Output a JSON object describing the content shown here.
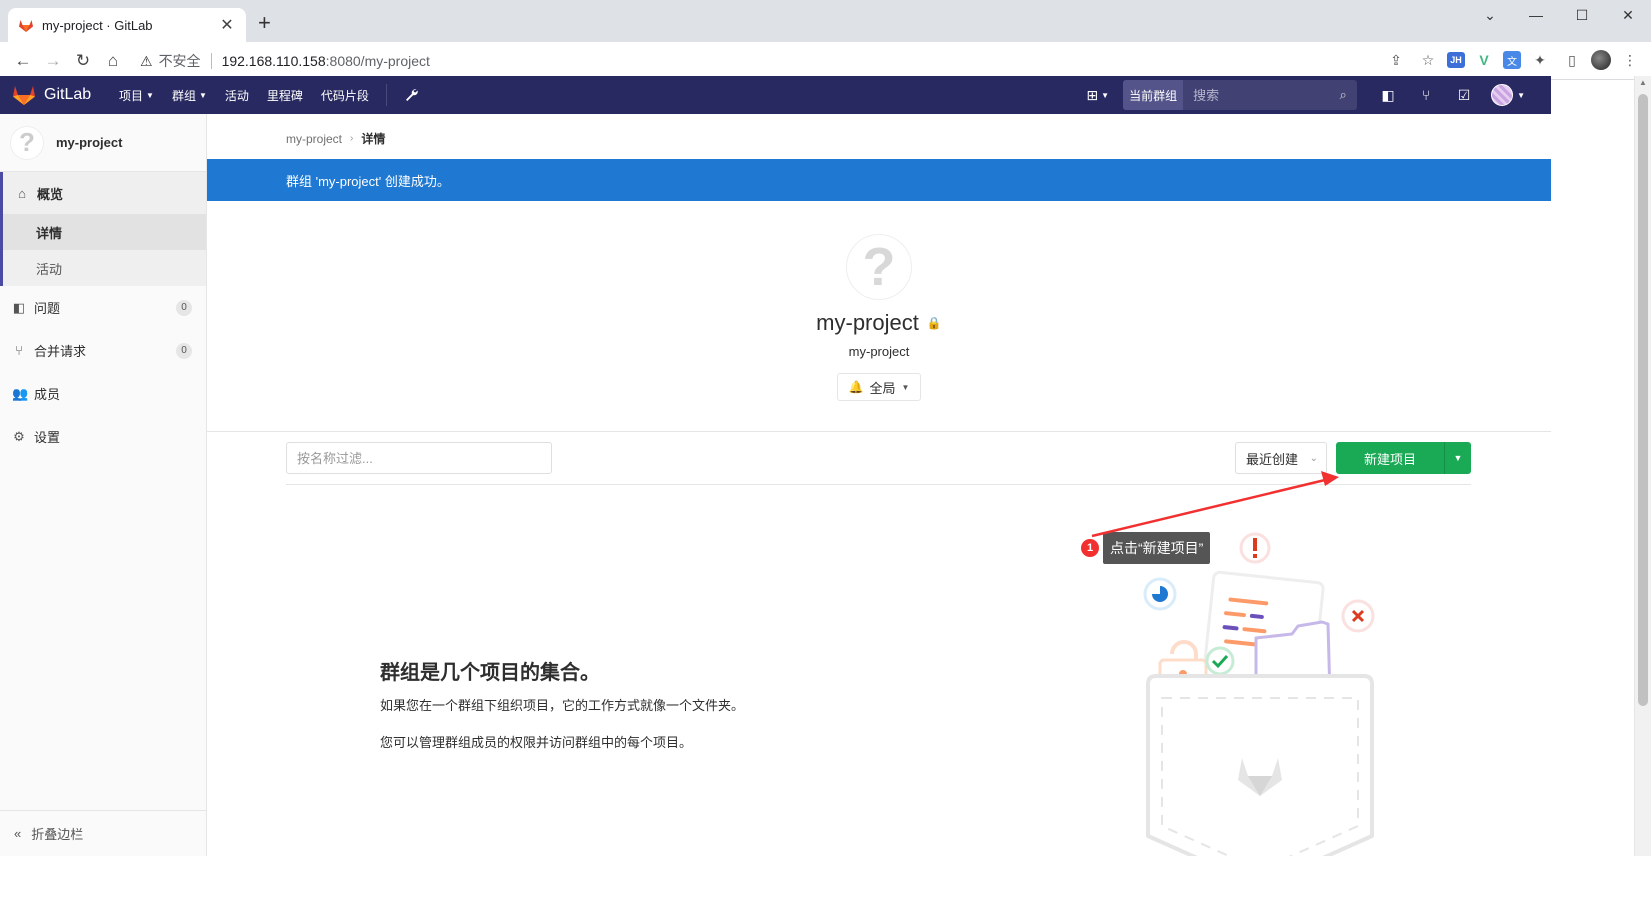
{
  "browser": {
    "tab_title": "my-project · GitLab",
    "new_tab": "+",
    "security_label": "不安全",
    "url_host": "192.168.110.158",
    "url_rest": ":8080/my-project"
  },
  "header": {
    "logo_text": "GitLab",
    "nav": {
      "projects": "项目",
      "groups": "群组",
      "activity": "活动",
      "milestones": "里程碑",
      "snippets": "代码片段"
    },
    "search_scope": "当前群组",
    "search_placeholder": "搜索"
  },
  "sidebar": {
    "title": "my-project",
    "overview": "概览",
    "details": "详情",
    "activity": "活动",
    "issues": "问题",
    "issues_count": "0",
    "merge_requests": "合并请求",
    "merge_requests_count": "0",
    "members": "成员",
    "settings": "设置",
    "collapse": "折叠边栏"
  },
  "breadcrumb": {
    "parent": "my-project",
    "current": "详情"
  },
  "flash": "群组 'my-project' 创建成功。",
  "group": {
    "name": "my-project",
    "path": "my-project",
    "notification": "全局"
  },
  "toolbar": {
    "filter_placeholder": "按名称过滤...",
    "sort_label": "最近创建",
    "new_project": "新建项目"
  },
  "empty_state": {
    "title": "群组是几个项目的集合。",
    "p1": "如果您在一个群组下组织项目，它的工作方式就像一个文件夹。",
    "p2": "您可以管理群组成员的权限并访问群组中的每个项目。"
  },
  "annotation": {
    "number": "1",
    "text": "点击“新建项目”"
  },
  "colors": {
    "header_bg": "#292961",
    "flash_bg": "#1f78d1",
    "button_green": "#1aaa55",
    "annotation_red": "#f23030"
  }
}
